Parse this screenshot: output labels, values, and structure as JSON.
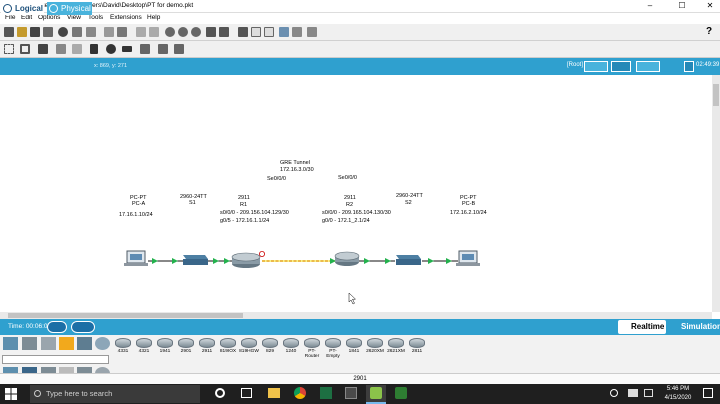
{
  "window": {
    "title": "Cisco Packet Tracer - C:\\Users\\David\\Desktop\\PT for demo.pkt",
    "minimize": "–",
    "maximize": "☐",
    "close": "✕"
  },
  "menu": [
    "File",
    "Edit",
    "Options",
    "View",
    "Tools",
    "Extensions",
    "Help"
  ],
  "help_glyph": "?",
  "tabs": {
    "logical": "Logical",
    "physical": "Physical",
    "coords": "x: 869, y: 271"
  },
  "root_label": "[Root]",
  "clock": "02:49:39",
  "topology": {
    "pca": {
      "type": "PC-PT",
      "name": "PC-A",
      "ip": "17.16.1.10/24"
    },
    "s1": {
      "model": "2960-24TT",
      "name": "S1"
    },
    "r1": {
      "model": "2911",
      "name": "R1",
      "if1": "s0/0/0 - 209.156.104.129/30",
      "if2": "g0/5 - 172.16.1.1/24"
    },
    "tunnel": {
      "label": "GRE Tunnel",
      "net": "172.16.3.0/30",
      "r1_port": "Se0/0/0",
      "r2_port": "Se0/0/0"
    },
    "r2": {
      "model": "2911",
      "name": "R2",
      "if1": "s0/0/0 - 209.165.104.130/30",
      "if2": "g0/0 - 172.1_2.1/24"
    },
    "s2": {
      "model": "2960-24TT",
      "name": "S2"
    },
    "pcb": {
      "type": "PC-PT",
      "name": "PC-B",
      "ip": "172.16.2.10/24"
    }
  },
  "bottom": {
    "time": "Time: 00:06:07",
    "realtime": "Realtime",
    "simulation": "Simulation",
    "devices": [
      "4331",
      "4321",
      "1941",
      "2901",
      "2911",
      "819IOX",
      "819HGW",
      "829",
      "1240",
      "PT-Router",
      "PT-Empty",
      "1841",
      "2620XM",
      "2621XM",
      "2811"
    ],
    "selected_device": "2901"
  },
  "taskbar": {
    "search_placeholder": "Type here to search",
    "time": "5:46 PM",
    "date": "4/15/2020"
  },
  "colors": {
    "accent": "#2fa0cf",
    "link_dot": "#23b14d",
    "tunnel": "#f6ef3a"
  }
}
